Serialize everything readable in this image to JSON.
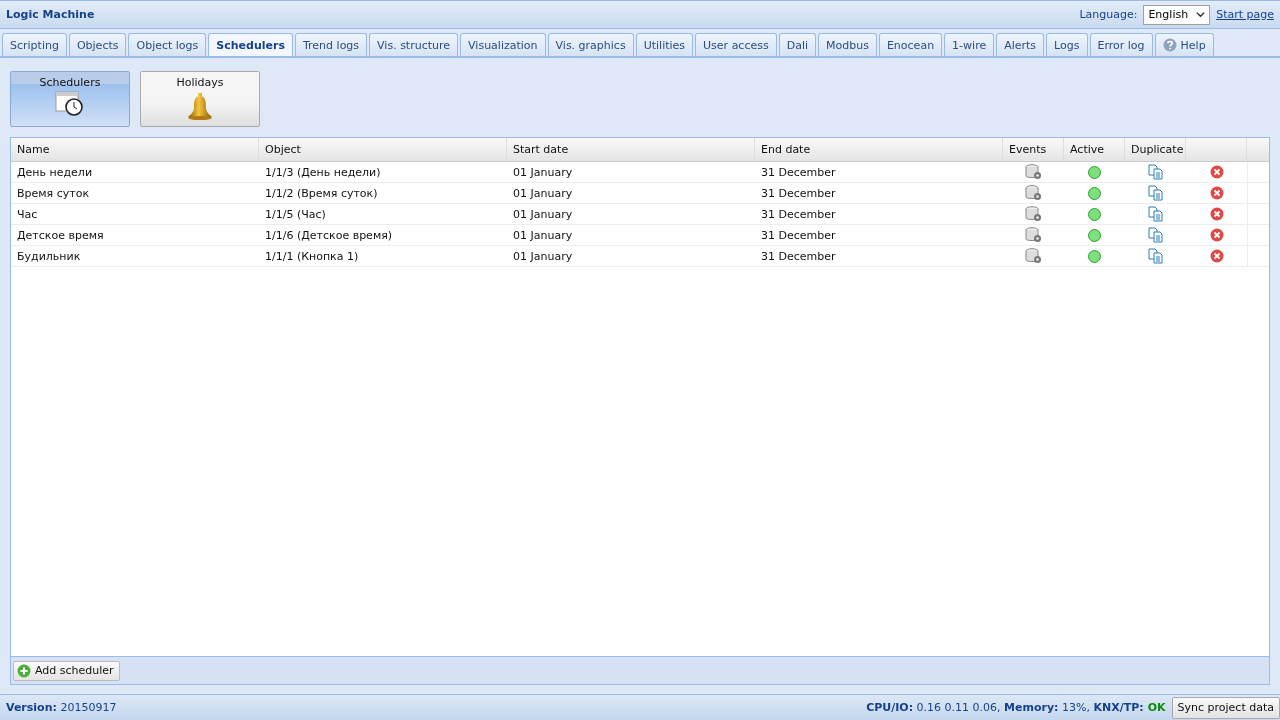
{
  "window": {
    "title": "Logic Machine"
  },
  "language": {
    "label": "Language:",
    "value": "English"
  },
  "start_page_link": "Start page",
  "tabs": [
    {
      "label": "Scripting",
      "selected": false,
      "kind": "plain"
    },
    {
      "label": "Objects",
      "selected": false,
      "kind": "plain"
    },
    {
      "label": "Object logs",
      "selected": false,
      "kind": "plain"
    },
    {
      "label": "Schedulers",
      "selected": true,
      "kind": "plain"
    },
    {
      "label": "Trend logs",
      "selected": false,
      "kind": "plain"
    },
    {
      "label": "Vis. structure",
      "selected": false,
      "kind": "plain"
    },
    {
      "label": "Visualization",
      "selected": false,
      "kind": "plain"
    },
    {
      "label": "Vis. graphics",
      "selected": false,
      "kind": "plain"
    },
    {
      "label": "Utilities",
      "selected": false,
      "kind": "plain"
    },
    {
      "label": "User access",
      "selected": false,
      "kind": "plain"
    },
    {
      "label": "Dali",
      "selected": false,
      "kind": "plain"
    },
    {
      "label": "Modbus",
      "selected": false,
      "kind": "plain"
    },
    {
      "label": "Enocean",
      "selected": false,
      "kind": "plain"
    },
    {
      "label": "1-wire",
      "selected": false,
      "kind": "plain"
    },
    {
      "label": "Alerts",
      "selected": false,
      "kind": "plain"
    },
    {
      "label": "Logs",
      "selected": false,
      "kind": "plain"
    },
    {
      "label": "Error log",
      "selected": false,
      "kind": "plain"
    },
    {
      "label": "Help",
      "selected": false,
      "kind": "help"
    }
  ],
  "mode_buttons": [
    {
      "label": "Schedulers",
      "selected": true,
      "kind": "calendar"
    },
    {
      "label": "Holidays",
      "selected": false,
      "kind": "bell"
    }
  ],
  "table": {
    "columns": [
      "Name",
      "Object",
      "Start date",
      "End date",
      "Events",
      "Active",
      "Duplicate"
    ],
    "rows": [
      {
        "name": "День недели",
        "object": "1/1/3 (День недели)",
        "start_date": "01 January",
        "end_date": "31 December",
        "active": true
      },
      {
        "name": "Время суток",
        "object": "1/1/2 (Время суток)",
        "start_date": "01 January",
        "end_date": "31 December",
        "active": true
      },
      {
        "name": "Час",
        "object": "1/1/5 (Час)",
        "start_date": "01 January",
        "end_date": "31 December",
        "active": true
      },
      {
        "name": "Детское время",
        "object": "1/1/6 (Детское время)",
        "start_date": "01 January",
        "end_date": "31 December",
        "active": true
      },
      {
        "name": "Будильник",
        "object": "1/1/1 (Кнопка 1)",
        "start_date": "01 January",
        "end_date": "31 December",
        "active": true
      }
    ]
  },
  "add_button": "Add scheduler",
  "status_bar": {
    "version": "**Version:** 20150917",
    "stats": "**CPU/IO:** 0.16 0.11 0.06, **Memory:** 13%, **KNX/TP:**",
    "knx_status": "OK",
    "sync_button": "Sync project data"
  }
}
